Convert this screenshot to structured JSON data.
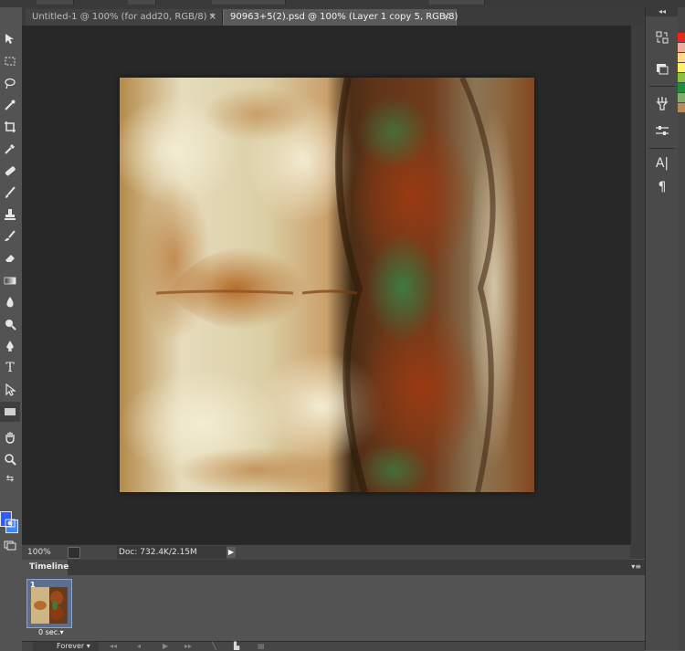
{
  "tabs": [
    {
      "label": "Untitled-1 @ 100% (for add20, RGB/8) *",
      "close": "×",
      "active": false
    },
    {
      "label": "90963+5(2).psd @ 100% (Layer 1 copy 5, RGB/8)",
      "close": "×",
      "active": true
    }
  ],
  "toolbar": {
    "tools": [
      "move-icon",
      "marquee-icon",
      "lasso-icon",
      "quick-select-icon",
      "crop-icon",
      "eyedropper-icon",
      "healing-brush-icon",
      "brush-icon",
      "clone-stamp-icon",
      "history-brush-icon",
      "eraser-icon",
      "gradient-icon",
      "blur-icon",
      "dodge-icon",
      "pen-icon",
      "type-tool-icon",
      "path-select-icon",
      "rectangle-icon",
      "hand-icon",
      "zoom-icon"
    ],
    "type_glyph": "T",
    "foreground_color": "#2c5cff",
    "background_color": "#3f86ff"
  },
  "dock": {
    "collapse_label": "◂◂",
    "buttons": [
      {
        "icon": "history-icon"
      },
      {
        "icon": "layer-comps-icon"
      },
      {
        "icon": "tool-presets-icon"
      },
      {
        "icon": "brush-presets-icon"
      },
      {
        "icon": "character-icon",
        "glyph": "A|"
      },
      {
        "icon": "paragraph-icon",
        "glyph": "¶"
      }
    ],
    "swatch_colors": [
      "#e8281c",
      "#f5a9a0",
      "#ffd98a",
      "#fff066",
      "#8ac23f",
      "#1d8f3a",
      "#b98a5a"
    ]
  },
  "status": {
    "zoom": "100%",
    "doc": "Doc: 732.4K/2.15M",
    "arrow": "▶"
  },
  "timeline": {
    "title": "Timeline",
    "menu": "▾≡",
    "frame_number": "1",
    "frame_delay": "0 sec.▾",
    "loop": "Forever",
    "loop_arrow": "▾",
    "controls": [
      "first-frame-icon",
      "prev-frame-icon",
      "play-icon",
      "next-frame-icon",
      "tween-icon",
      "duplicate-frame-icon",
      "delete-frame-icon"
    ]
  }
}
